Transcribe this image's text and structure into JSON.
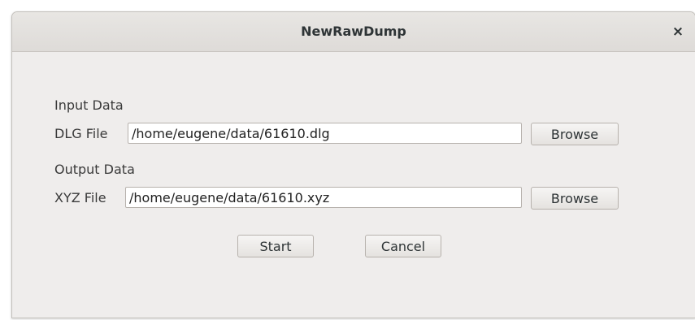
{
  "window": {
    "title": "NewRawDump",
    "close_glyph": "×",
    "close_icon": "close-icon"
  },
  "input": {
    "section_label": "Input Data",
    "file_label": "DLG File",
    "file_value": "/home/eugene/data/61610.dlg",
    "browse_label": "Browse"
  },
  "output": {
    "section_label": "Output Data",
    "file_label": "XYZ File",
    "file_value": "/home/eugene/data/61610.xyz",
    "browse_label": "Browse"
  },
  "actions": {
    "start_label": "Start",
    "cancel_label": "Cancel"
  }
}
